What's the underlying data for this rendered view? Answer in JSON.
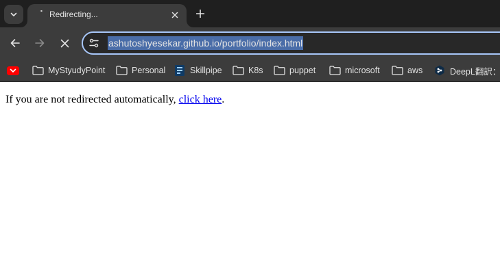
{
  "tab": {
    "title": "Redirecting..."
  },
  "omnibox": {
    "url": "ashutoshyesekar.github.io/portfolio/index.html"
  },
  "bookmarks": [
    {
      "label": "",
      "icon": "youtube-icon"
    },
    {
      "label": "MyStyudyPoint",
      "icon": "folder-icon"
    },
    {
      "label": "Personal",
      "icon": "folder-icon"
    },
    {
      "label": "Skillpipe",
      "icon": "skillpipe-icon"
    },
    {
      "label": "K8s",
      "icon": "folder-icon"
    },
    {
      "label": "puppet",
      "icon": "folder-icon"
    },
    {
      "label": "microsoft",
      "icon": "folder-icon"
    },
    {
      "label": "aws",
      "icon": "folder-icon"
    },
    {
      "label": "DeepL翻訳：世",
      "icon": "deepl-icon"
    }
  ],
  "page": {
    "text_before": "If you are not redirected automatically, ",
    "link_text": "click here",
    "text_after": "."
  },
  "colors": {
    "tabstrip_bg": "#1f1f1f",
    "toolbar_bg": "#3c3c3c",
    "omnibox_border": "#a8c7fa",
    "link": "#0000ee"
  }
}
